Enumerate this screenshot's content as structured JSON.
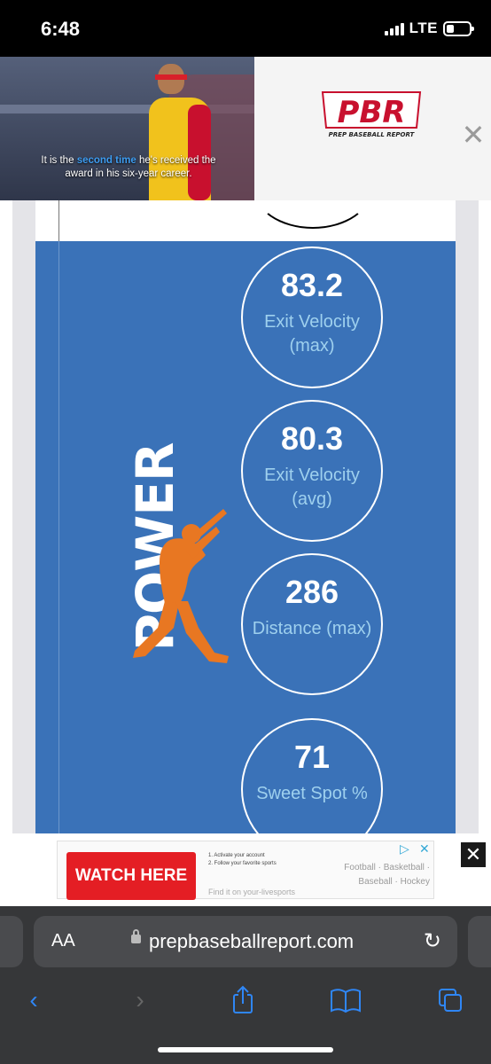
{
  "status_bar": {
    "time": "6:48",
    "network": "LTE"
  },
  "ad_top": {
    "caption_before": "It is the ",
    "caption_highlight": "second time",
    "caption_after": " he's received the award in his six-year career.",
    "logo_text": "PBR",
    "logo_subtext": "PREP BASEBALL REPORT",
    "close_glyph": "✕"
  },
  "power_section": {
    "title": "POWER",
    "colors": {
      "panel": "#3a72b8",
      "label": "#9ed0ee",
      "batter": "#e87722"
    },
    "stats": [
      {
        "value": "83.2",
        "label": "Exit Velocity (max)"
      },
      {
        "value": "80.3",
        "label": "Exit Velocity (avg)"
      },
      {
        "value": "286",
        "label": "Distance (max)"
      },
      {
        "value": "71",
        "label": "Sweet Spot %"
      }
    ]
  },
  "ad_bottom": {
    "button": "WATCH HERE",
    "steps": [
      "1. Activate your account",
      "2. Follow your favorite sports"
    ],
    "sports_line1": "Football · Basketball ·",
    "sports_line2": "Baseball · Hockey",
    "find_text": "Find it on your-livesports",
    "close_glyph": "✕"
  },
  "browser": {
    "aa_label": "AA",
    "url": "prepbaseballreport.com",
    "reload_glyph": "↻",
    "toolbar": {
      "back_glyph": "‹",
      "forward_glyph": "›",
      "share_glyph": "⇪",
      "bookmarks_glyph": "📖",
      "tabs_glyph": "⧉"
    }
  }
}
